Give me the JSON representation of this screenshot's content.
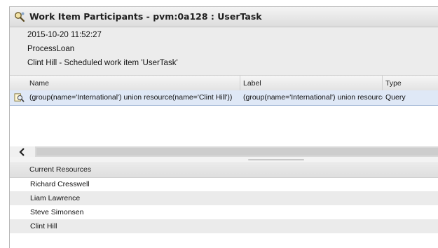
{
  "window": {
    "title": "Work Item Participants - pvm:0a128 : UserTask"
  },
  "info": {
    "timestamp": "2015-10-20 11:52:27",
    "process": "ProcessLoan",
    "description": "Clint Hill - Scheduled work item 'UserTask'"
  },
  "participants_table": {
    "columns": [
      "Name",
      "Label",
      "Type"
    ],
    "rows": [
      {
        "name": "(group(name='International') union resource(name='Clint Hill'))",
        "label": "(group(name='International') union resource(",
        "type": "Query"
      }
    ]
  },
  "resources": {
    "header": "Current Resources",
    "items": [
      "Richard Cresswell",
      "Liam Lawrence",
      "Steve Simonsen",
      "Clint Hill"
    ]
  },
  "icons": {
    "title": "participants-search-icon",
    "row": "query-search-icon",
    "scroll_left": "chevron-left-icon"
  }
}
